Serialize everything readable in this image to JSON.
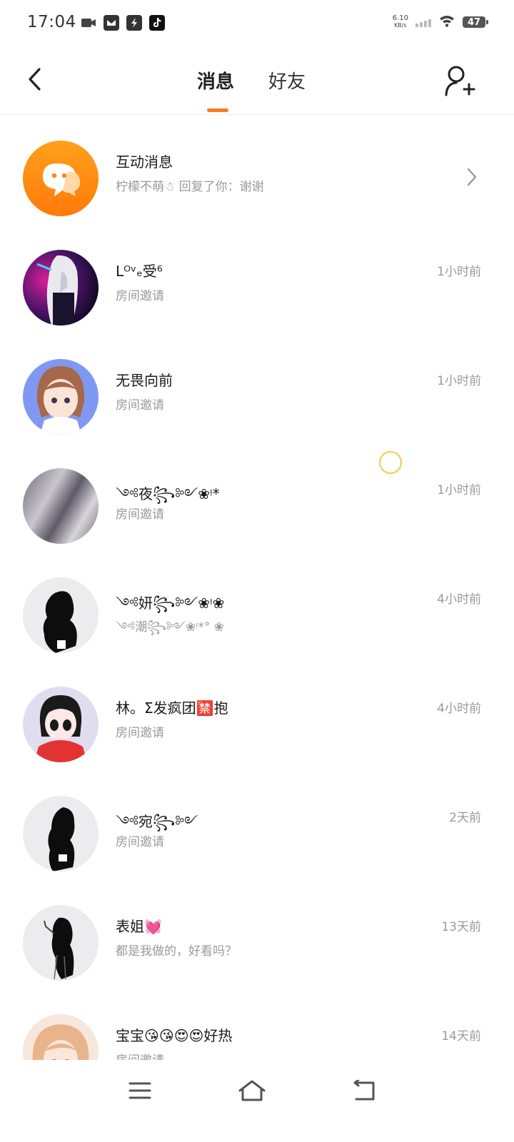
{
  "status_bar": {
    "time": "17:04",
    "net_speed_value": "6.10",
    "net_speed_unit": "KB/s",
    "battery": "47",
    "app_icons": [
      "video-icon",
      "app-icon",
      "flash-icon",
      "tiktok-icon"
    ]
  },
  "header": {
    "tabs": [
      {
        "label": "消息",
        "active": true
      },
      {
        "label": "好友",
        "active": false
      }
    ],
    "accent_color": "#ff7a1a"
  },
  "messages": [
    {
      "name": "互动消息",
      "preview": "柠檬不萌☃ 回复了你：谢谢",
      "time": "",
      "avatar": "interaction-icon"
    },
    {
      "name": "Lᴼᵛₑ受⁶",
      "preview": "房间邀请",
      "time": "1小时前",
      "avatar": "anime-dark"
    },
    {
      "name": "无畏向前",
      "preview": "房间邀请",
      "time": "1小时前",
      "avatar": "anime-girl"
    },
    {
      "name": "༺夜꧂༻❀ᵎ*",
      "preview": "房间邀请",
      "time": "1小时前",
      "avatar": "gray-texture"
    },
    {
      "name": "༺妍꧂༻❀ᵎ❀",
      "preview": "༺潮꧂༻❀ᵎ*° ❀",
      "time": "4小时前",
      "avatar": "silhouette"
    },
    {
      "name": "林。Σ发疯团🈲抱",
      "preview": "房间邀请",
      "time": "4小时前",
      "avatar": "red-hoodie"
    },
    {
      "name": "༺宛꧂༻",
      "preview": "房间邀请",
      "time": "2天前",
      "avatar": "silhouette"
    },
    {
      "name": "表姐💓",
      "preview": "都是我做的，好看吗？",
      "time": "13天前",
      "avatar": "sketch-girl"
    },
    {
      "name": "宝宝😘😘😍😍好热",
      "preview": "房间邀请",
      "time": "14天前",
      "avatar": "blonde-girl"
    }
  ],
  "bottom_nav": [
    "menu-icon",
    "home-icon",
    "back-icon"
  ]
}
